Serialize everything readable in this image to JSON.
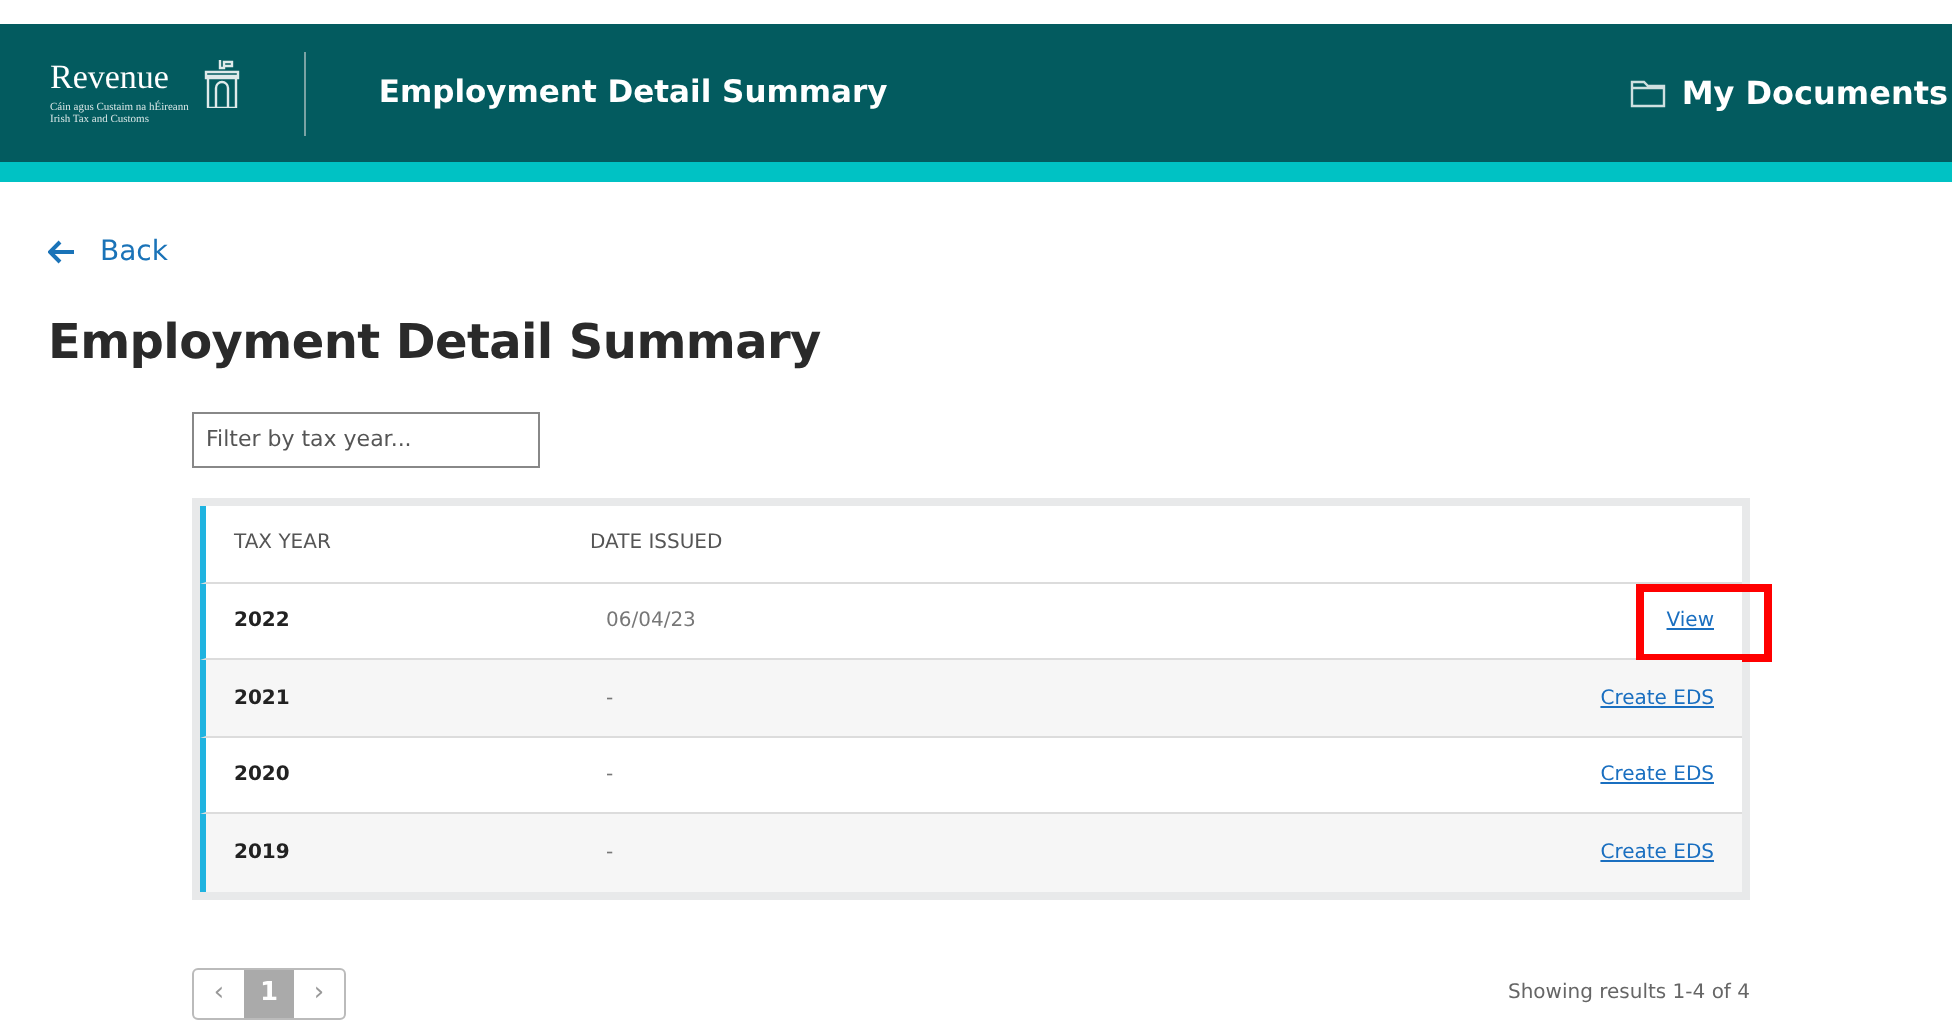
{
  "header": {
    "logo": {
      "name": "Revenue",
      "subtitle_lines": [
        "Cáin agus Custaim na hÉireann",
        "Irish Tax and Customs"
      ]
    },
    "title": "Employment Detail Summary",
    "documents_link": "My Documents"
  },
  "back_link": "Back",
  "page_title": "Employment Detail Summary",
  "filter": {
    "placeholder": "Filter by tax year..."
  },
  "table": {
    "columns": [
      "TAX YEAR",
      "DATE ISSUED"
    ],
    "rows": [
      {
        "tax_year": "2022",
        "date_issued": "06/04/23",
        "action": "View",
        "highlighted": true
      },
      {
        "tax_year": "2021",
        "date_issued": "-",
        "action": "Create EDS",
        "highlighted": false
      },
      {
        "tax_year": "2020",
        "date_issued": "-",
        "action": "Create EDS",
        "highlighted": false
      },
      {
        "tax_year": "2019",
        "date_issued": "-",
        "action": "Create EDS",
        "highlighted": false
      }
    ]
  },
  "pagination": {
    "prev": "‹",
    "pages": [
      {
        "label": "1",
        "selected": true
      }
    ],
    "next": "›"
  },
  "results_summary": "Showing results 1-4 of 4"
}
